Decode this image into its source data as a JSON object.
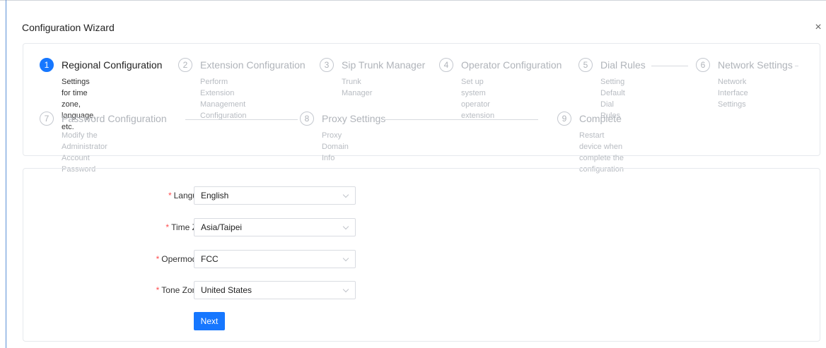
{
  "dialog": {
    "title": "Configuration Wizard",
    "close_glyph": "×"
  },
  "steps": [
    {
      "number": "1",
      "title": "Regional Configuration",
      "desc_lines": [
        "Settings for time zone,",
        "language, etc."
      ]
    },
    {
      "number": "2",
      "title": "Extension Configuration",
      "desc_lines": [
        "Perform Extension",
        "Management Configuration"
      ]
    },
    {
      "number": "3",
      "title": "Sip Trunk Manager",
      "desc_lines": [
        "Trunk Manager"
      ]
    },
    {
      "number": "4",
      "title": "Operator Configuration",
      "desc_lines": [
        "Set up system operator",
        "extension"
      ]
    },
    {
      "number": "5",
      "title": "Dial Rules",
      "desc_lines": [
        "Setting Default Dial",
        "Rules"
      ]
    },
    {
      "number": "6",
      "title": "Network Settings",
      "desc_lines": [
        "Network Interface",
        "Settings"
      ]
    },
    {
      "number": "7",
      "title": "Password Configuration",
      "desc_lines": [
        "Modify the Administrator Account Password"
      ]
    },
    {
      "number": "8",
      "title": "Proxy Settings",
      "desc_lines": [
        "Proxy Domain Info"
      ]
    },
    {
      "number": "9",
      "title": "Complete",
      "desc_lines": [
        "Restart device when complete the configuration"
      ]
    }
  ],
  "form": {
    "language": {
      "label": "Language",
      "value": "English"
    },
    "time_zone": {
      "label": "Time Zone",
      "value": "Asia/Taipei"
    },
    "opermode": {
      "label": "Opermode",
      "value": "FCC"
    },
    "tone_zone": {
      "label": "Tone Zone",
      "value": "United States"
    },
    "required_mark": "*",
    "help_glyph": "?",
    "next_label": "Next"
  },
  "colors": {
    "accent": "#1677ff",
    "required": "#ff4d4f"
  }
}
